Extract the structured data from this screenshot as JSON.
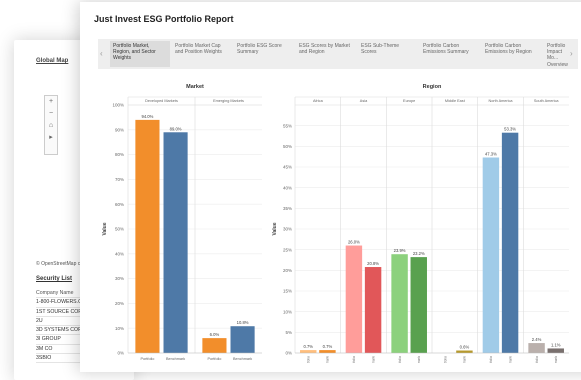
{
  "back_window": {
    "global_map_title": "Global Map",
    "map_controls": [
      "+",
      "−",
      "⌂",
      "▸"
    ],
    "osm_credit": "© OpenStreetMap contri",
    "security_list_title": "Security List",
    "security_list_header": "Company Name",
    "companies": [
      "1-800-FLOWERS.COM",
      "1ST SOURCE CORP",
      "2U",
      "3D SYSTEMS CORP",
      "3I GROUP",
      "3M CO",
      "3SBIO"
    ]
  },
  "report": {
    "title": "Just Invest ESG Portfolio Report",
    "tabs": [
      "Portfolio Market, Region, and Sector Weights",
      "Portfolio Market Cap and Position Weights",
      "Portfolio ESG Score Summary",
      "ESG Scores by Market and Region",
      "ESG Sub-Theme Scores",
      "Portfolio Carbon Emissions Summary",
      "Portfolio Carbon Emissions by Region",
      "Portfolio Impact Mo... Overview"
    ],
    "prev_arrow": "‹",
    "next_arrow": "›"
  },
  "colors": {
    "portfolio": "#f28e2b",
    "benchmark": "#4e79a7"
  },
  "chart_data": [
    {
      "type": "bar",
      "title": "Market",
      "ylabel": "Value",
      "ylim": [
        0,
        100
      ],
      "yticks": [
        "0%",
        "10%",
        "20%",
        "30%",
        "40%",
        "50%",
        "60%",
        "70%",
        "80%",
        "90%",
        "100%"
      ],
      "groups": [
        "Developed Markets",
        "Emerging Markets"
      ],
      "categories": [
        "Portfolio",
        "Benchmark"
      ],
      "values": [
        [
          94.0,
          89.0
        ],
        [
          6.0,
          10.8
        ]
      ],
      "labels": [
        [
          "94.0%",
          "89.0%"
        ],
        [
          "6.0%",
          "10.8%"
        ]
      ],
      "colors": [
        [
          "#f28e2b",
          "#4e79a7"
        ],
        [
          "#f28e2b",
          "#4e79a7"
        ]
      ]
    },
    {
      "type": "bar",
      "title": "Region",
      "ylabel": "Value",
      "ylim": [
        0,
        60
      ],
      "yticks": [
        "0%",
        "5%",
        "10%",
        "15%",
        "20%",
        "25%",
        "30%",
        "35%",
        "40%",
        "45%",
        "50%",
        "55%"
      ],
      "groups": [
        "Africa",
        "Asia",
        "Europe",
        "Middle East",
        "North America",
        "South America"
      ],
      "categories": [
        "Portfolio",
        "Benchmark"
      ],
      "values": [
        [
          0.7,
          0.7
        ],
        [
          26.0,
          20.8
        ],
        [
          23.9,
          23.2
        ],
        [
          0.0,
          0.6
        ],
        [
          47.3,
          53.3
        ],
        [
          2.4,
          1.1
        ]
      ],
      "labels": [
        [
          "0.7%",
          "0.7%"
        ],
        [
          "26.0%",
          "20.8%"
        ],
        [
          "23.9%",
          "23.2%"
        ],
        [
          "",
          "0.6%"
        ],
        [
          "47.3%",
          "53.3%"
        ],
        [
          "2.4%",
          "1.1%"
        ]
      ],
      "colors": [
        [
          "#ffbe7d",
          "#f28e2b"
        ],
        [
          "#ff9d9a",
          "#e15759"
        ],
        [
          "#8cd17d",
          "#59a14f"
        ],
        [
          "#f1ce63",
          "#b6992d"
        ],
        [
          "#a0cbe8",
          "#4e79a7"
        ],
        [
          "#bab0ac",
          "#79706e"
        ]
      ]
    }
  ]
}
